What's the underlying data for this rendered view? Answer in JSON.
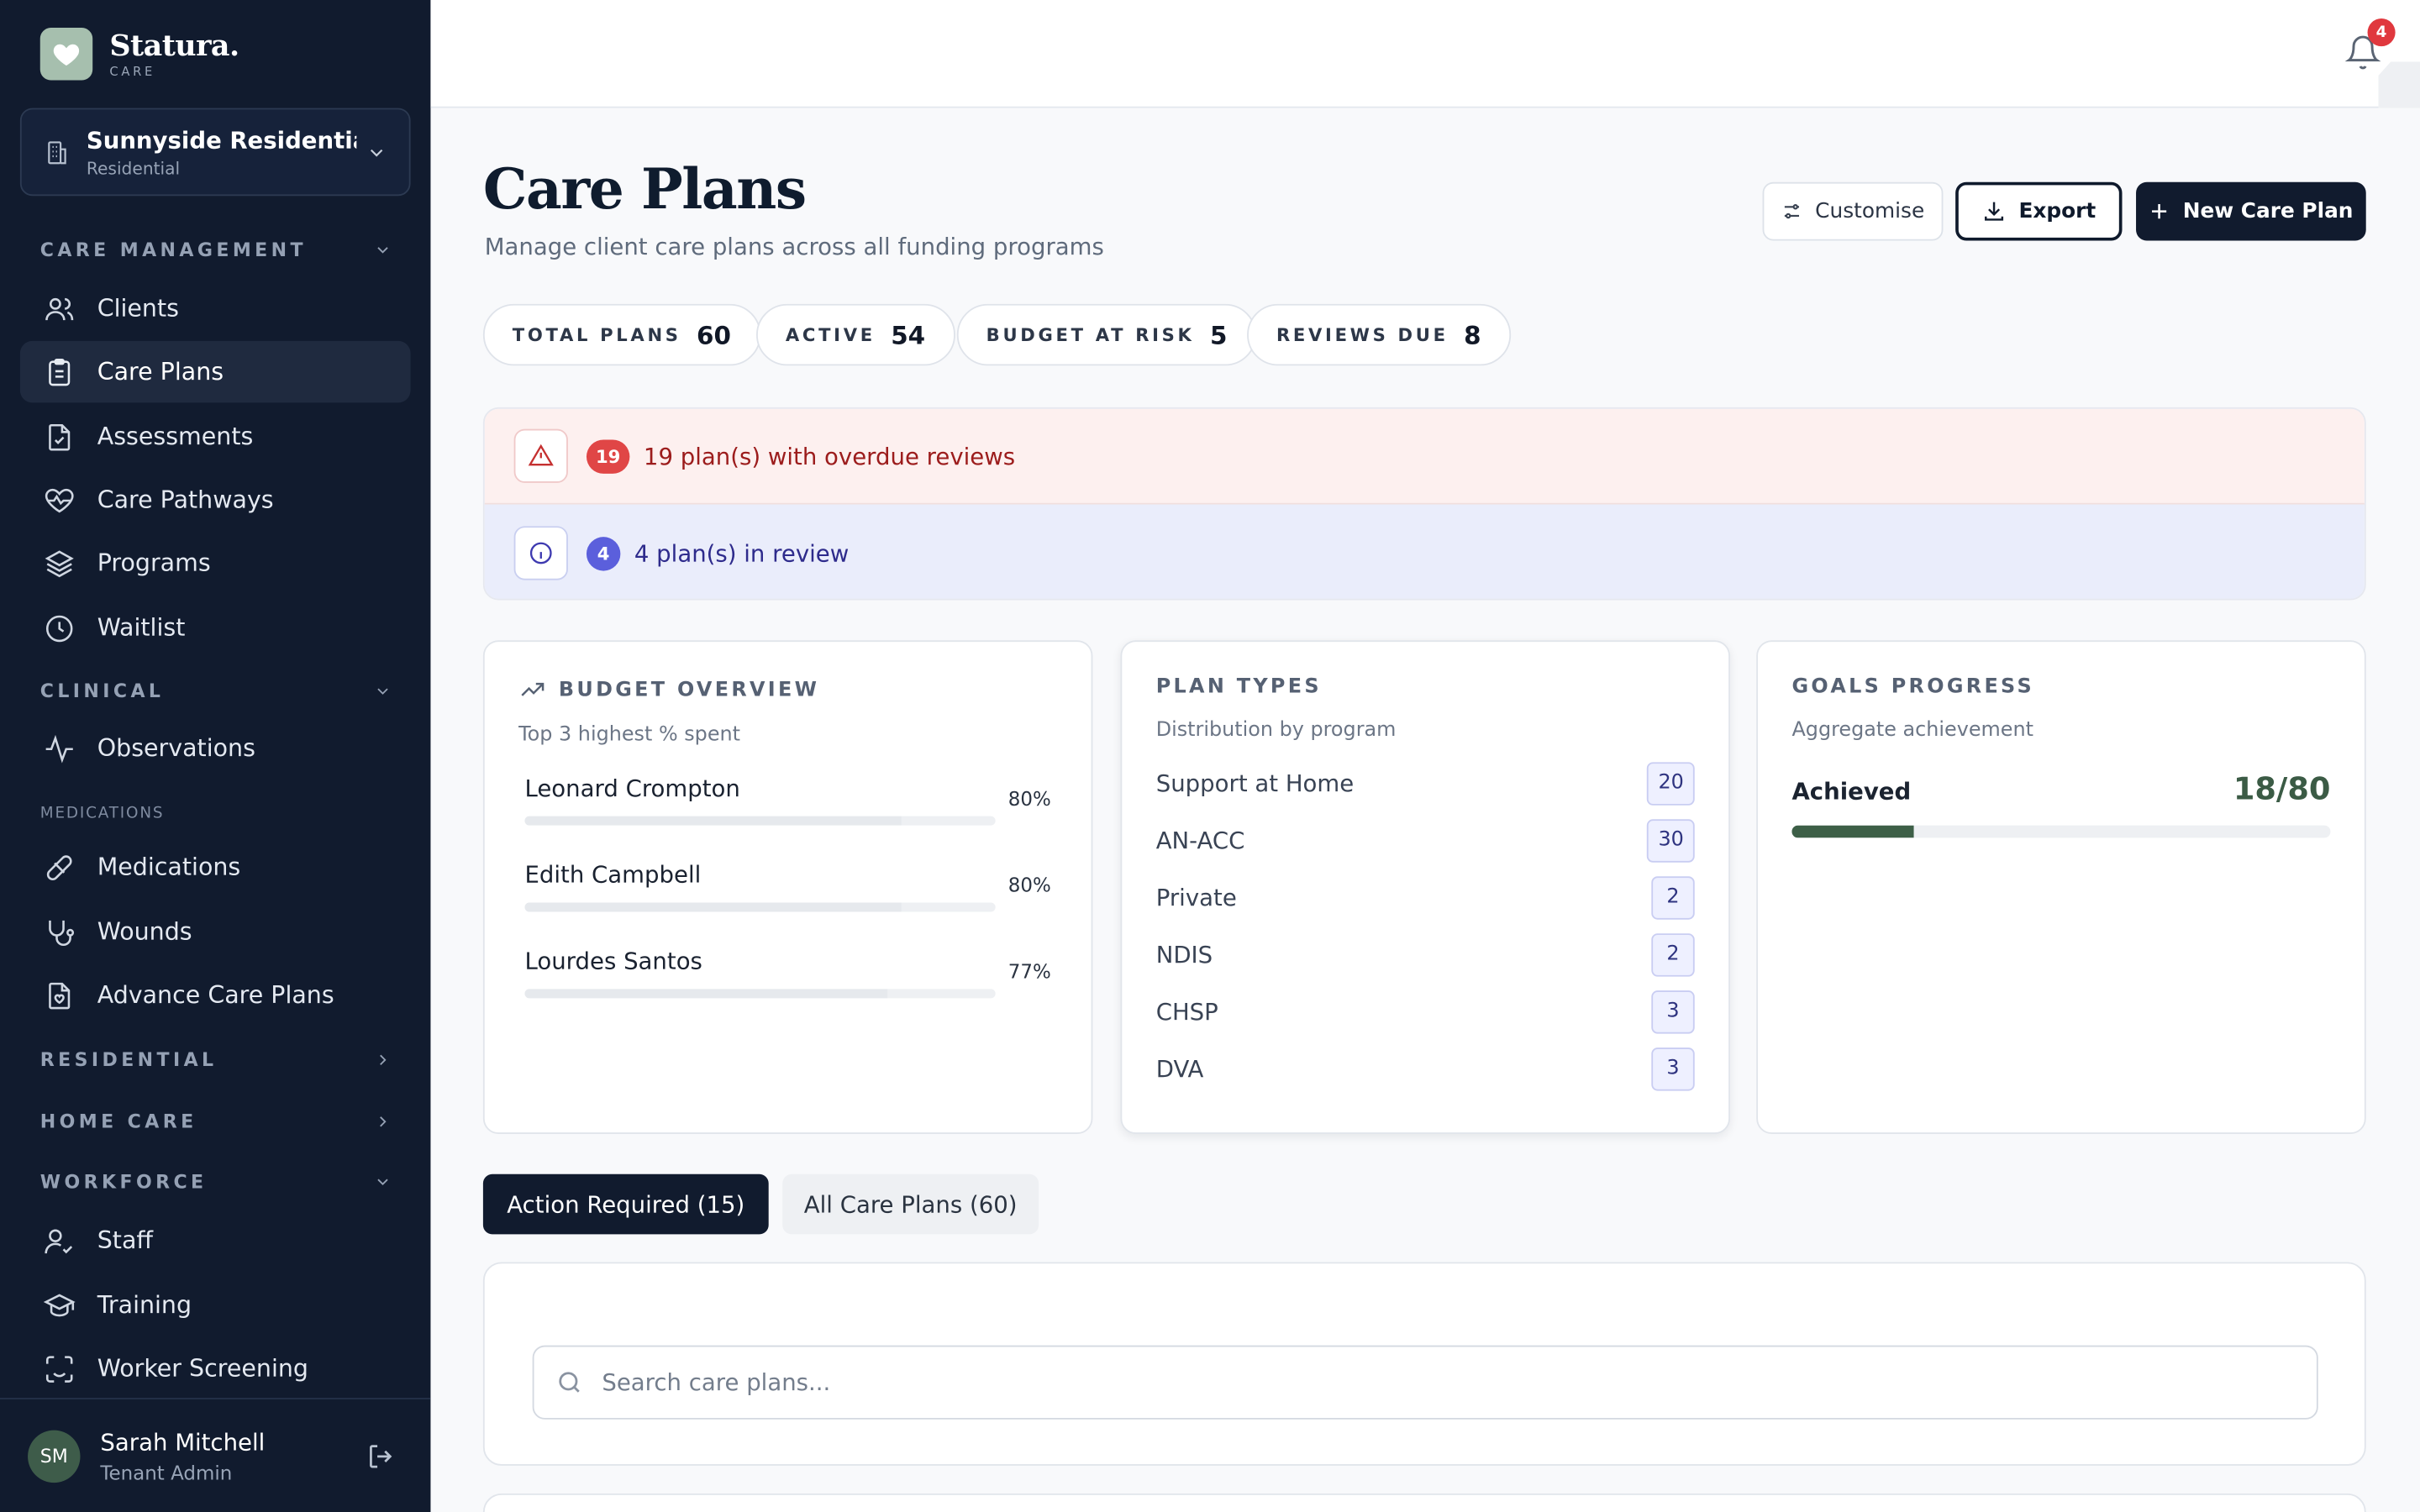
{
  "brand": {
    "name": "Statura.",
    "sub": "CARE"
  },
  "facility": {
    "name": "Sunnyside Residentia...",
    "type": "Residential"
  },
  "sidebar": {
    "sections": {
      "care_management": "CARE MANAGEMENT",
      "clinical": "CLINICAL",
      "medications": "MEDICATIONS",
      "residential": "RESIDENTIAL",
      "home_care": "HOME CARE",
      "workforce": "WORKFORCE"
    },
    "items": {
      "clients": "Clients",
      "care_plans": "Care Plans",
      "assessments": "Assessments",
      "care_pathways": "Care Pathways",
      "programs": "Programs",
      "waitlist": "Waitlist",
      "observations": "Observations",
      "medications": "Medications",
      "wounds": "Wounds",
      "advance_care_plans": "Advance Care Plans",
      "staff": "Staff",
      "training": "Training",
      "worker_screening": "Worker Screening"
    },
    "active_item": "care_plans"
  },
  "user": {
    "initials": "SM",
    "name": "Sarah Mitchell",
    "role": "Tenant Admin"
  },
  "topbar": {
    "notification_count": "4"
  },
  "page": {
    "title": "Care Plans",
    "subtitle": "Manage client care plans across all funding programs",
    "buttons": {
      "customise": "Customise",
      "export": "Export",
      "new": "New Care Plan"
    }
  },
  "stats": [
    {
      "label": "TOTAL PLANS",
      "value": "60"
    },
    {
      "label": "ACTIVE",
      "value": "54"
    },
    {
      "label": "BUDGET AT RISK",
      "value": "5"
    },
    {
      "label": "REVIEWS DUE",
      "value": "8"
    }
  ],
  "alerts": {
    "overdue": {
      "count": "19",
      "text": "19 plan(s) with overdue reviews"
    },
    "review": {
      "count": "4",
      "text": "4 plan(s) in review"
    }
  },
  "budget": {
    "title": "BUDGET OVERVIEW",
    "subtitle": "Top 3 highest % spent",
    "rows": [
      {
        "name": "Leonard Crompton",
        "pct_label": "80%",
        "pct": 0.8
      },
      {
        "name": "Edith Campbell",
        "pct_label": "80%",
        "pct": 0.8
      },
      {
        "name": "Lourdes Santos",
        "pct_label": "77%",
        "pct": 0.77
      }
    ]
  },
  "plan_types": {
    "title": "PLAN TYPES",
    "subtitle": "Distribution by program",
    "rows": [
      {
        "name": "Support at Home",
        "value": "20"
      },
      {
        "name": "AN-ACC",
        "value": "30"
      },
      {
        "name": "Private",
        "value": "2"
      },
      {
        "name": "NDIS",
        "value": "2"
      },
      {
        "name": "CHSP",
        "value": "3"
      },
      {
        "name": "DVA",
        "value": "3"
      }
    ]
  },
  "goals": {
    "title": "GOALS PROGRESS",
    "subtitle": "Aggregate achievement",
    "label": "Achieved",
    "value": "18/80",
    "fraction": 0.225
  },
  "tabs": {
    "action_required": "Action Required (15)",
    "all": "All Care Plans (60)"
  },
  "search": {
    "placeholder": "Search care plans..."
  },
  "colors": {
    "sidebar_bg": "#111b2e",
    "accent_green": "#3d5f47",
    "danger": "#e04646",
    "info": "#5b5fdc"
  }
}
